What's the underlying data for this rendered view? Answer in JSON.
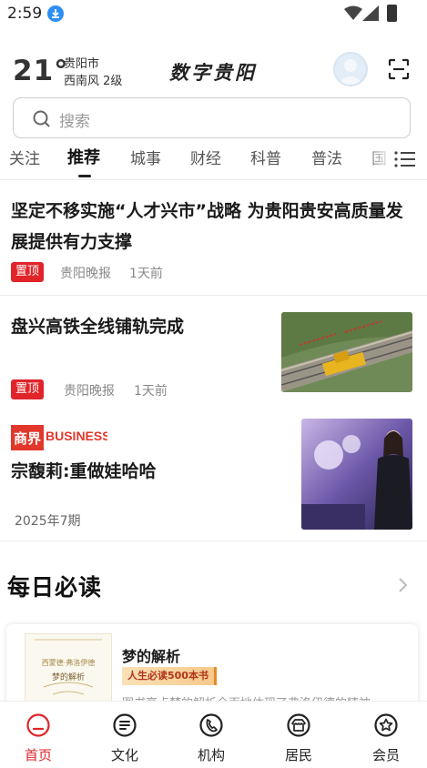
{
  "status_bar": {
    "time": "2:59"
  },
  "header": {
    "temperature": "21°",
    "city": "贵阳市",
    "wind": "西南风  2级",
    "logo_text": "数字贵阳"
  },
  "search": {
    "placeholder": "搜索"
  },
  "tabs": [
    "关注",
    "推荐",
    "城事",
    "财经",
    "科普",
    "普法",
    "国"
  ],
  "active_tab": "推荐",
  "articles": [
    {
      "title": "坚定不移实施“人才兴市”战略    为贵阳贵安高质量发展提供有力支撑",
      "badge": "置顶",
      "source": "贵阳晚报",
      "time": "1天前"
    },
    {
      "title": "盘兴高铁全线铺轨完成",
      "badge": "置顶",
      "source": "贵阳晚报",
      "time": "1天前"
    },
    {
      "brand_cn": "商界",
      "brand_en": "BUSINESS",
      "title": "宗馥莉:重做娃哈哈",
      "issue": "2025年7期"
    }
  ],
  "daily_read": {
    "section_title": "每日必读",
    "book": {
      "title": "梦的解析",
      "tag": "人生必读500本书",
      "description": "图书亮点梦的解析全面地体现了弗洛伊德的精神",
      "cover_small_text": "西蒙德·弗洛伊德",
      "cover_title": "梦的解析"
    }
  },
  "bottom_nav": [
    {
      "label": "首页",
      "icon": "home-icon",
      "active": true
    },
    {
      "label": "文化",
      "icon": "culture-icon",
      "active": false
    },
    {
      "label": "机构",
      "icon": "institution-icon",
      "active": false
    },
    {
      "label": "居民",
      "icon": "resident-icon",
      "active": false
    },
    {
      "label": "会员",
      "icon": "member-icon",
      "active": false
    }
  ],
  "colors": {
    "accent": "#e0242a",
    "text": "#1a1a1a",
    "muted": "#888888"
  }
}
